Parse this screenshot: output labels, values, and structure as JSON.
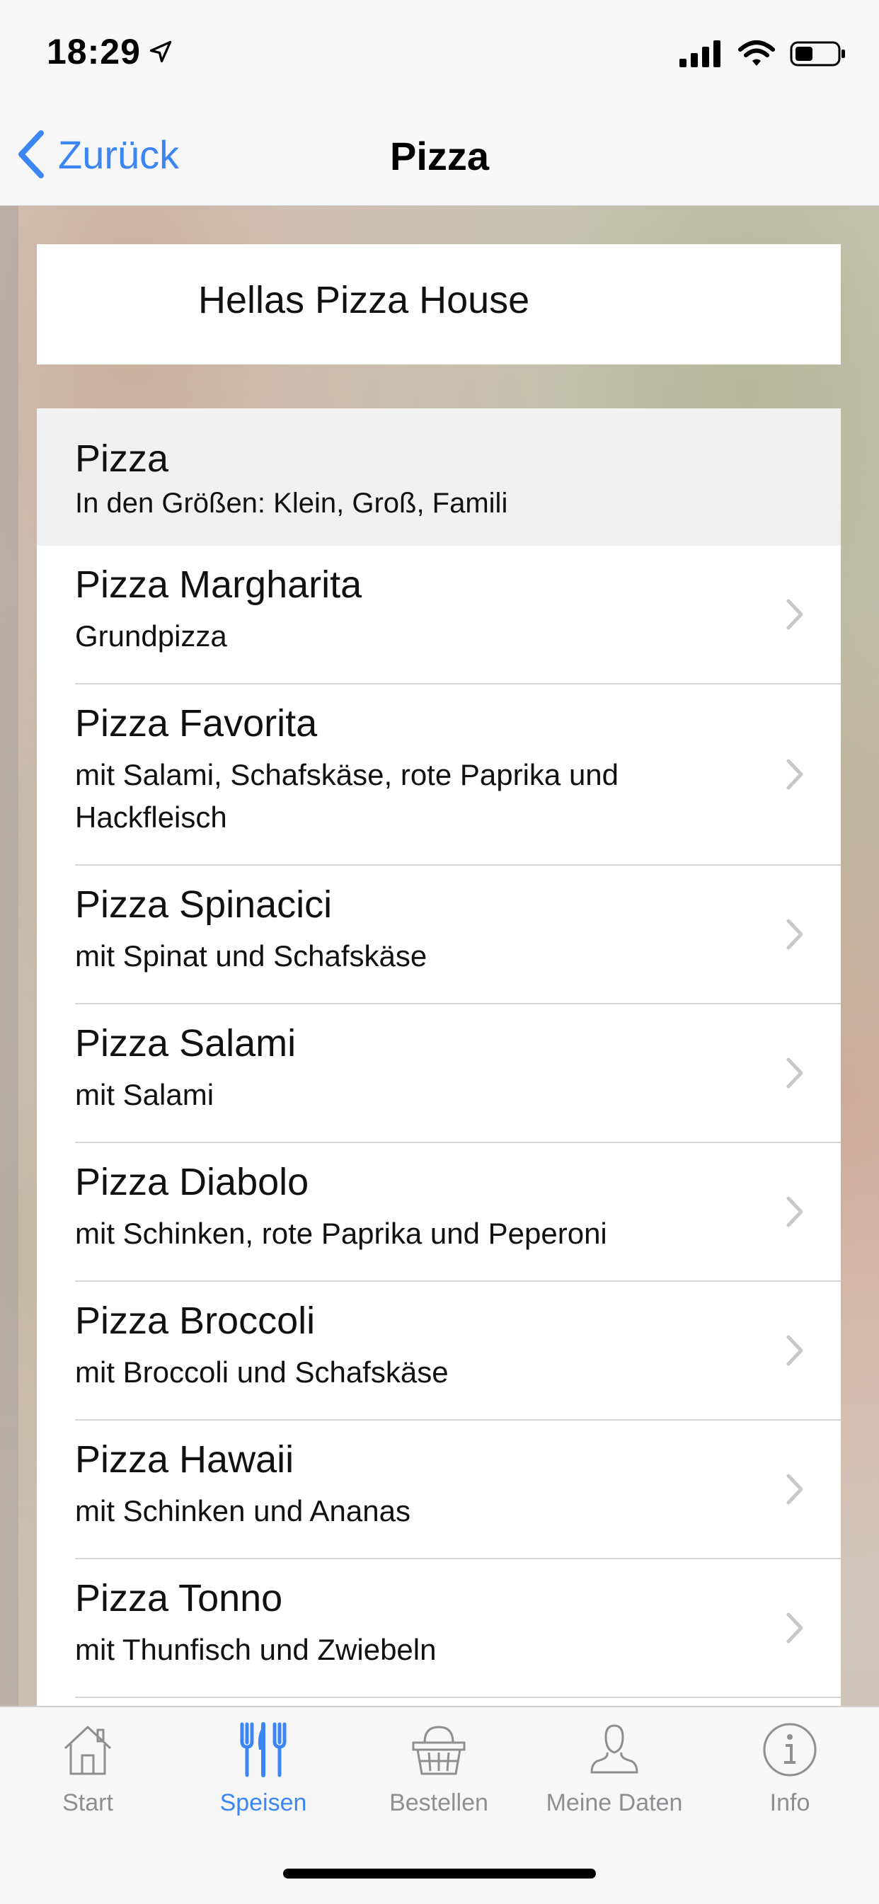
{
  "status": {
    "time": "18:29"
  },
  "nav": {
    "back_label": "Zurück",
    "title": "Pizza"
  },
  "restaurant": {
    "name": "Hellas Pizza House"
  },
  "section": {
    "title": "Pizza",
    "subtitle": "In den Größen: Klein, Groß, Famili"
  },
  "items": [
    {
      "title": "Pizza Margharita",
      "desc": "Grundpizza"
    },
    {
      "title": "Pizza Favorita",
      "desc": "mit Salami, Schafskäse, rote Paprika und Hackfleisch"
    },
    {
      "title": "Pizza Spinacici",
      "desc": "mit Spinat und Schafskäse"
    },
    {
      "title": "Pizza Salami",
      "desc": "mit Salami"
    },
    {
      "title": "Pizza Diabolo",
      "desc": "mit Schinken, rote Paprika und Peperoni"
    },
    {
      "title": "Pizza Broccoli",
      "desc": "mit Broccoli und Schafskäse"
    },
    {
      "title": "Pizza Hawaii",
      "desc": "mit Schinken und Ananas"
    },
    {
      "title": "Pizza Tonno",
      "desc": "mit Thunfisch und Zwiebeln"
    }
  ],
  "tabs": [
    {
      "label": "Start",
      "icon": "home-icon"
    },
    {
      "label": "Speisen",
      "icon": "cutlery-icon",
      "active": true
    },
    {
      "label": "Bestellen",
      "icon": "basket-icon"
    },
    {
      "label": "Meine Daten",
      "icon": "person-icon"
    },
    {
      "label": "Info",
      "icon": "info-icon"
    }
  ],
  "colors": {
    "accent": "#3c86f4",
    "inactive": "#8e8e93"
  }
}
